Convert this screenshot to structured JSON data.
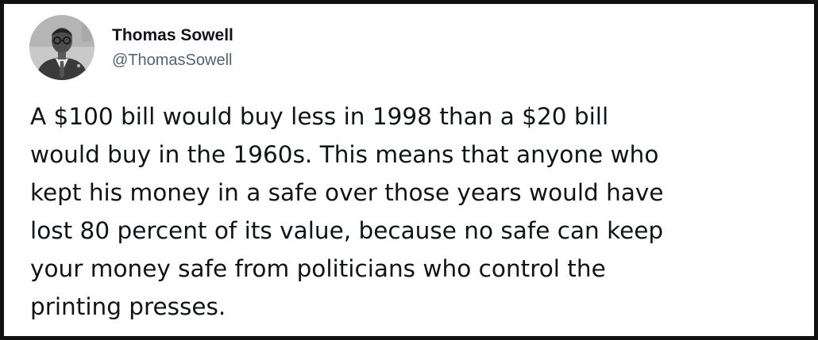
{
  "author": {
    "display_name": "Thomas Sowell",
    "handle": "@ThomasSowell",
    "avatar_icon": "profile-photo-avatar"
  },
  "tweet": {
    "lines": [
      "A $100 bill would buy less in 1998 than a $20 bill",
      "would buy in the 1960s. This means that anyone who",
      "kept his money in a safe over those years would have",
      "lost 80 percent of its value, because no safe can keep",
      "your money safe from politicians who control the",
      "printing presses."
    ]
  },
  "colors": {
    "border": "#111111",
    "text": "#0f1419",
    "handle": "#536471",
    "background": "#ffffff"
  }
}
